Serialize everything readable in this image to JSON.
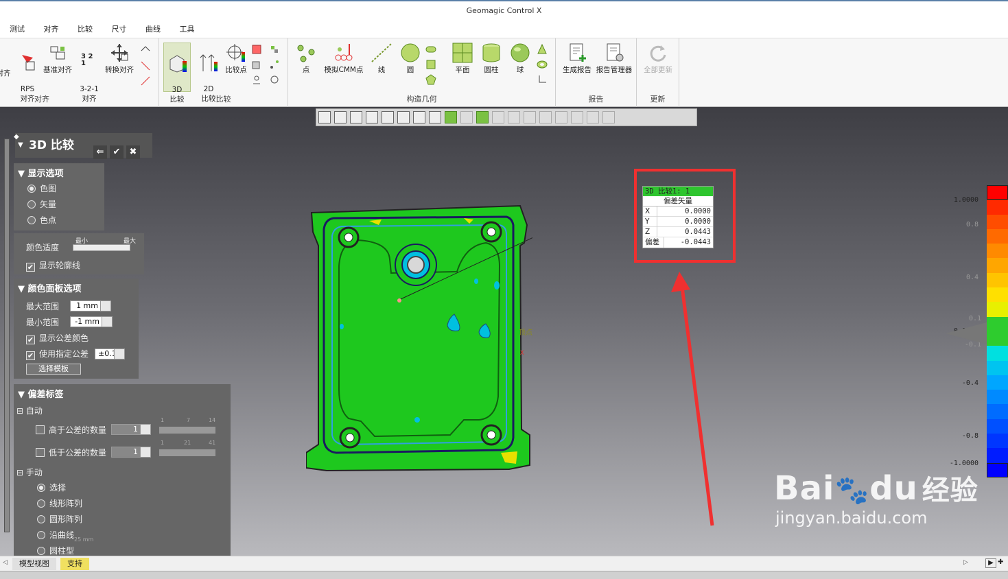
{
  "window": {
    "title": "Geomagic Control X"
  },
  "menu": [
    "测试",
    "对齐",
    "比较",
    "尺寸",
    "曲线",
    "工具"
  ],
  "ribbon": {
    "groups": {
      "align": "对齐",
      "compare": "比较",
      "construct": "构造几何",
      "report": "报告",
      "update": "更新"
    },
    "buttons": {
      "partial": "对齐",
      "rps": "RPS\n对齐",
      "datum": "基准对齐",
      "three21": "3-2-1\n对齐",
      "transform": "转换对齐",
      "compare3d": "3D\n比较",
      "compare2d": "2D\n比较",
      "compare_pt": "比较点",
      "point": "点",
      "cmm": "模拟CMM点",
      "line": "线",
      "circle": "圆",
      "plane": "平面",
      "cylinder": "圆柱",
      "sphere": "球",
      "gen_report": "生成报告",
      "report_mgr": "报告管理器",
      "update_all": "全部更新"
    },
    "icon_labels": {
      "three21": "3 2\n1"
    }
  },
  "panel": {
    "title": "3D 比较",
    "display": {
      "title": "显示选项",
      "options": [
        "色图",
        "矢量",
        "色点"
      ],
      "selected": 0
    },
    "color": {
      "smooth_label": "颜色适度",
      "min": "最小",
      "max": "最大",
      "show_outline": "显示轮廓线"
    },
    "palette": {
      "title": "颜色面板选项",
      "max_label": "最大范围",
      "max_value": "1 mm",
      "min_label": "最小范围",
      "min_value": "-1 mm",
      "show_tol_color": "显示公差颜色",
      "use_tol": "使用指定公差",
      "tol_value": "±0.1",
      "template_btn": "选择模板"
    },
    "dev_label": {
      "title": "偏差标签",
      "auto": "自动",
      "above": "高于公差的数量",
      "above_val": "1",
      "above_ticks": [
        "1",
        "7",
        "14"
      ],
      "below": "低于公差的数量",
      "below_val": "1",
      "below_ticks": [
        "1",
        "21",
        "41"
      ],
      "manual": "手动",
      "manual_options": [
        "选择",
        "线形阵列",
        "圆形阵列",
        "沿曲线",
        "圆柱型"
      ],
      "manual_selected": 0
    }
  },
  "viewport": {
    "vertex_label": "顶点",
    "axis_x": "X",
    "scale_unit": "25 mm"
  },
  "callout": {
    "title": "3D 比较1: 1",
    "header": "偏差矢量",
    "rows": [
      {
        "k": "X",
        "v": "0.0000"
      },
      {
        "k": "Y",
        "v": "0.0000"
      },
      {
        "k": "Z",
        "v": "0.0443"
      },
      {
        "k": "偏差",
        "v": "-0.0443"
      }
    ]
  },
  "scale": {
    "ticks": [
      "1.0000",
      "0.8",
      "0.4",
      "0.1",
      "0.0000",
      "-0.1",
      "-0.4",
      "-0.8",
      "-1.0000"
    ],
    "colors": [
      "#ff0000",
      "#ff2a00",
      "#ff4d00",
      "#ff6a00",
      "#ff8a00",
      "#ffa600",
      "#ffc400",
      "#ffe000",
      "#e8f000",
      "#2ecc2e",
      "#2ecc2e",
      "#00e0e0",
      "#00c4f0",
      "#00a6ff",
      "#008aff",
      "#006cff",
      "#0050ff",
      "#0036ff",
      "#001cff",
      "#0000ff"
    ]
  },
  "status": {
    "tab1": "模型视图",
    "tab2": "支持"
  },
  "watermark": {
    "brand": "Bai",
    "paw": "du",
    "suffix": "经验",
    "url": "jingyan.baidu.com"
  }
}
